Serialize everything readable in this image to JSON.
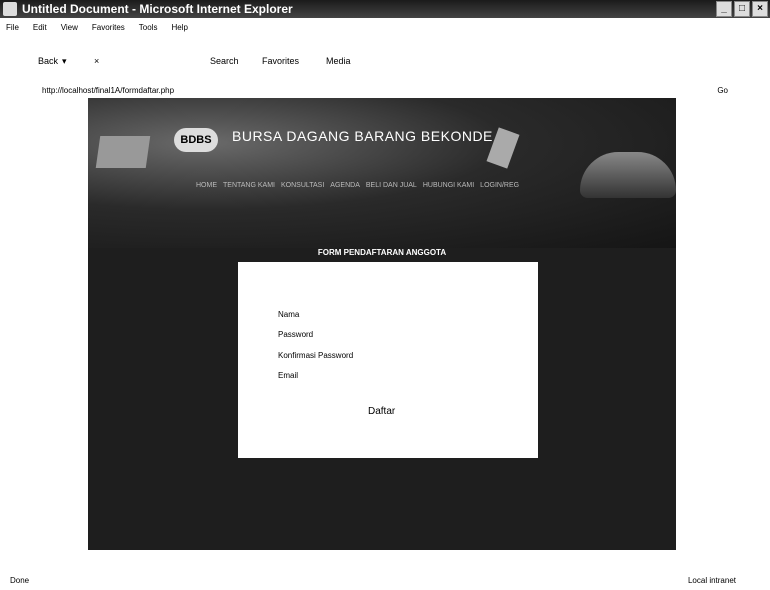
{
  "window": {
    "title": "Untitled Document - Microsoft Internet Explorer"
  },
  "menu": [
    "File",
    "Edit",
    "View",
    "Favorites",
    "Tools",
    "Help"
  ],
  "toolbar": {
    "back": "Back",
    "search": "Search",
    "favorites": "Favorites",
    "media": "Media"
  },
  "address": {
    "url": "http://localhost/final1A/formdaftar.php",
    "go": "Go"
  },
  "site": {
    "logo": "BDBS",
    "title": "BURSA DAGANG BARANG BEKONDE",
    "nav": [
      "HOME",
      "TENTANG KAMI",
      "KONSULTASI",
      "AGENDA",
      "BELI DAN JUAL",
      "HUBUNGI KAMI",
      "LOGIN/REG"
    ]
  },
  "form": {
    "title": "FORM PENDAFTARAN ANGGOTA",
    "fields": [
      "Nama",
      "Password",
      "Konfirmasi Password",
      "Email"
    ],
    "submit": "Daftar"
  },
  "status": {
    "left": "Done",
    "right": "Local intranet"
  }
}
